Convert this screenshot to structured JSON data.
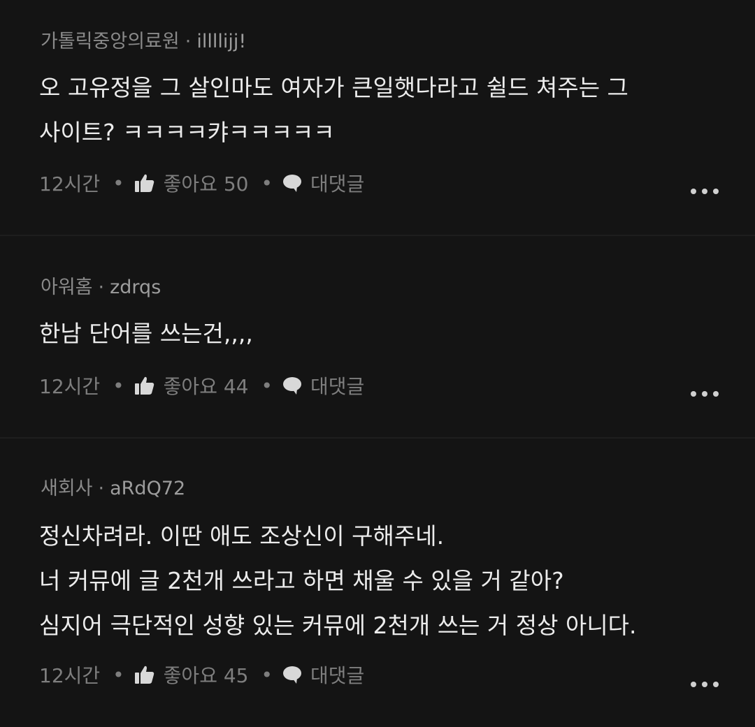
{
  "comments": [
    {
      "community": "가톨릭중앙의료원",
      "separator": "·",
      "user": "illllijj!",
      "text": "오 고유정을 그 살인마도 여자가 큰일햇다라고 쉴드 쳐주는 그\n사이트? ㅋㅋㅋㅋ캬ㅋㅋㅋㅋㅋ",
      "time": "12시간",
      "like_label": "좋아요 50",
      "reply_label": "대댓글"
    },
    {
      "community": "아워홈",
      "separator": "·",
      "user": "zdrqs",
      "text": "한남 단어를 쓰는건,,,,",
      "time": "12시간",
      "like_label": "좋아요 44",
      "reply_label": "대댓글"
    },
    {
      "community": "새회사",
      "separator": "·",
      "user": "aRdQ72",
      "text": "정신차려라. 이딴 애도 조상신이 구해주네.\n너 커뮤에 글 2천개 쓰라고 하면 채울 수 있을 거 같아?\n심지어 극단적인 성향 있는 커뮤에 2천개 쓰는 거 정상 아니다.",
      "time": "12시간",
      "like_label": "좋아요 45",
      "reply_label": "대댓글"
    }
  ],
  "action_separator": "•",
  "icons": {
    "like": "thumbs-up-icon",
    "reply": "speech-bubble-icon",
    "more": "more-dots-icon"
  }
}
